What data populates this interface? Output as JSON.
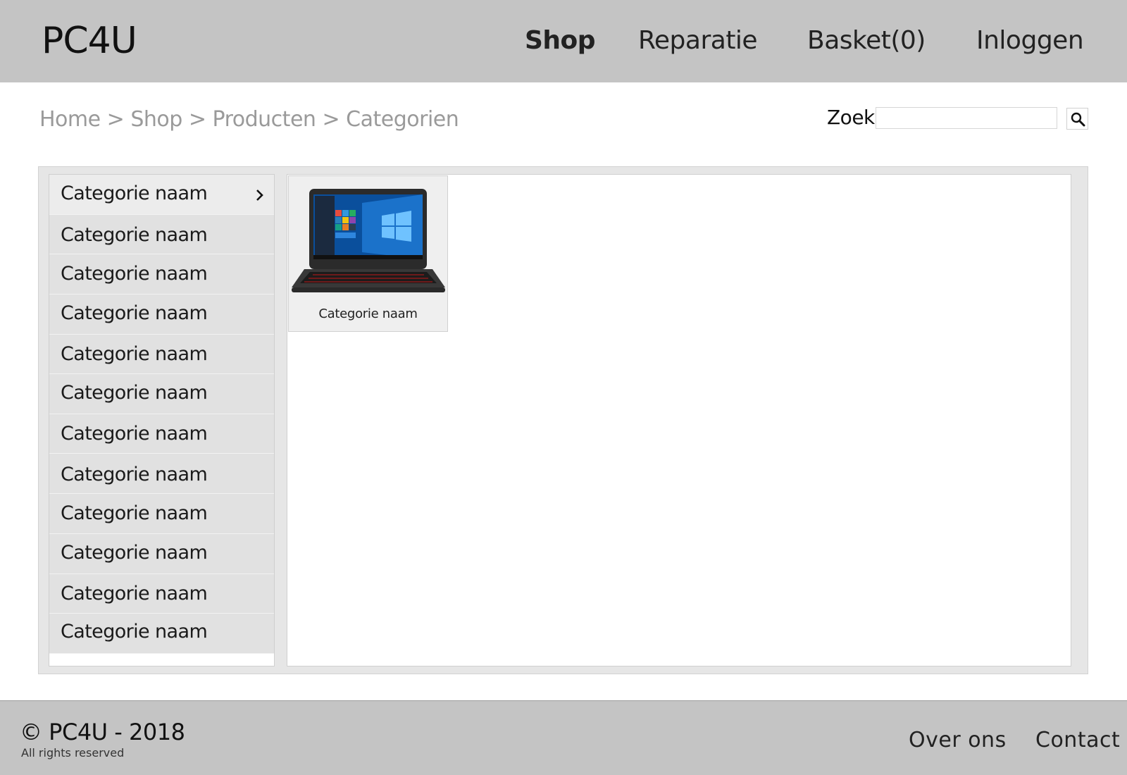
{
  "header": {
    "logo": "PC4U",
    "nav": [
      {
        "label": "Shop",
        "active": true
      },
      {
        "label": "Reparatie",
        "active": false
      },
      {
        "label": "Basket(0)",
        "active": false
      },
      {
        "label": "Inloggen",
        "active": false
      }
    ]
  },
  "breadcrumb": {
    "items": [
      "Home",
      "Shop",
      "Producten",
      "Categorien"
    ],
    "separator": ">"
  },
  "search": {
    "label": "Zoek:",
    "value": "",
    "placeholder": "",
    "button_icon": "search-icon"
  },
  "sidebar": {
    "items": [
      {
        "label": "Categorie naam",
        "active": true,
        "icon": "chevron-right-icon"
      },
      {
        "label": "Categorie naam"
      },
      {
        "label": "Categorie naam"
      },
      {
        "label": "Categorie naam"
      },
      {
        "label": "Categorie naam"
      },
      {
        "label": "Categorie naam"
      },
      {
        "label": "Categorie naam"
      },
      {
        "label": "Categorie naam"
      },
      {
        "label": "Categorie naam"
      },
      {
        "label": "Categorie naam"
      },
      {
        "label": "Categorie naam"
      },
      {
        "label": "Categorie naam"
      }
    ]
  },
  "main": {
    "cards": [
      {
        "label": "Categorie naam",
        "image": "laptop-image"
      }
    ]
  },
  "footer": {
    "copyright": "© PC4U - 2018",
    "rights": "All rights reserved",
    "links": [
      "Over ons",
      "Contact"
    ]
  },
  "colors": {
    "header_bg": "#c4c4c4",
    "footer_bg": "#c4c4c4",
    "sidebar_item_bg": "#e1e1e1",
    "breadcrumb_text": "#9a9a9a"
  }
}
